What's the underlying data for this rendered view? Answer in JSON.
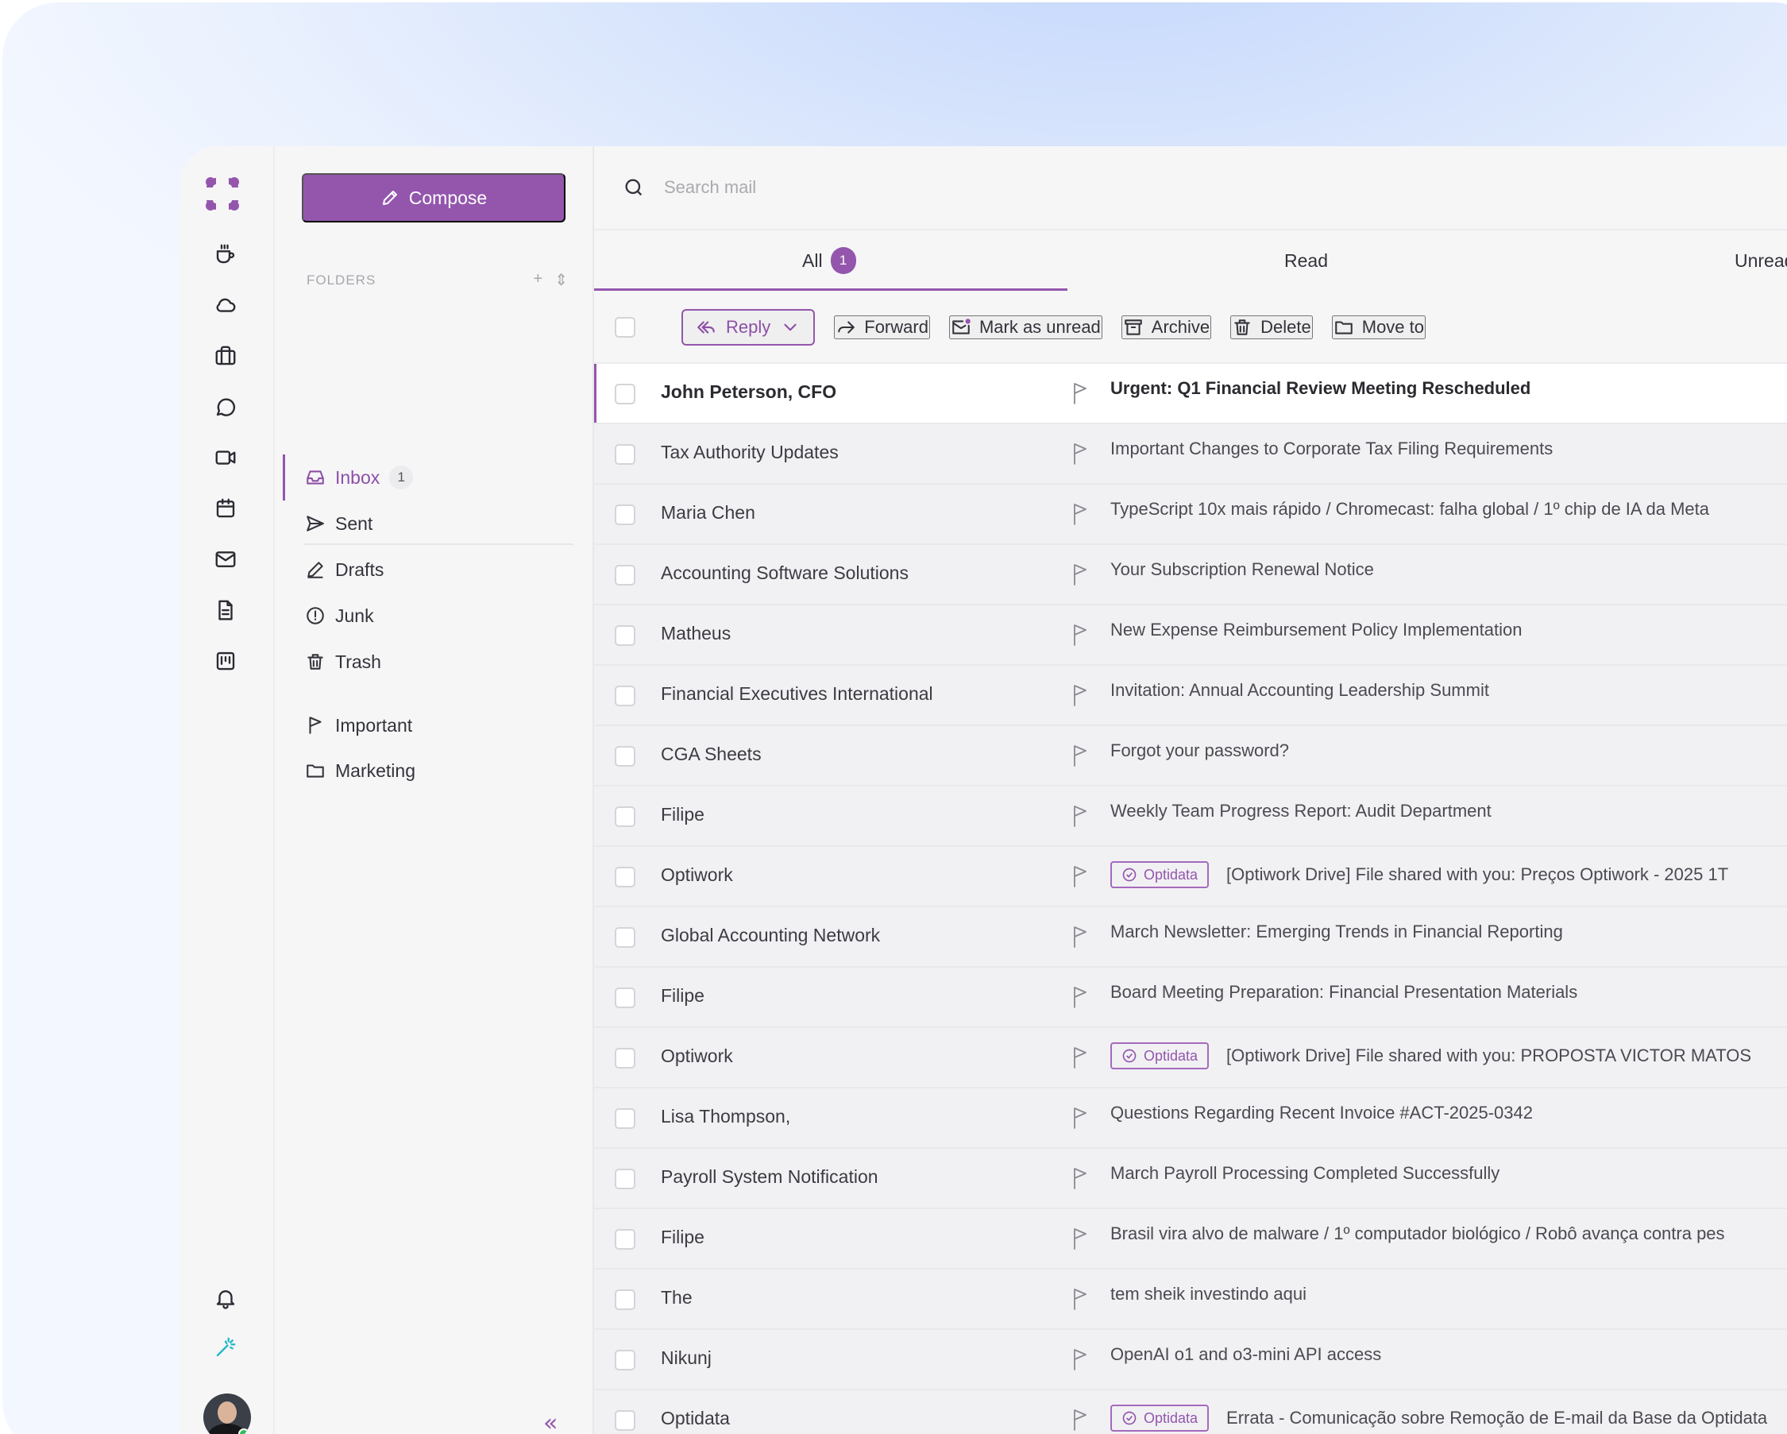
{
  "compose_label": "Compose",
  "folders_heading": "FOLDERS",
  "folders": [
    {
      "label": "Inbox",
      "count": "1",
      "icon": "inbox-icon"
    },
    {
      "label": "Sent",
      "icon": "send-icon"
    },
    {
      "label": "Drafts",
      "icon": "pencil-icon"
    },
    {
      "label": "Junk",
      "icon": "alert-icon"
    },
    {
      "label": "Trash",
      "icon": "trash-icon"
    }
  ],
  "custom_folders": [
    {
      "label": "Important",
      "icon": "flag-icon"
    },
    {
      "label": "Marketing",
      "icon": "folder-icon"
    }
  ],
  "search_placeholder": "Search mail",
  "tabs": [
    {
      "label": "All",
      "badge": "1"
    },
    {
      "label": "Read"
    },
    {
      "label": "Unread"
    }
  ],
  "toolbar": {
    "reply": "Reply",
    "forward": "Forward",
    "mark_unread": "Mark as unread",
    "archive": "Archive",
    "delete": "Delete",
    "move_to": "Move to"
  },
  "emails": [
    {
      "sender": "John Peterson, CFO",
      "subject": "Urgent: Q1 Financial Review Meeting Rescheduled",
      "unread": true
    },
    {
      "sender": "Tax Authority Updates",
      "subject": "Important Changes to Corporate Tax Filing Requirements"
    },
    {
      "sender": "Maria Chen",
      "subject": "TypeScript 10x mais rápido / Chromecast: falha global / 1º chip de IA da Meta"
    },
    {
      "sender": "Accounting Software Solutions",
      "subject": "Your Subscription Renewal Notice"
    },
    {
      "sender": "Matheus",
      "subject": "New Expense Reimbursement Policy Implementation"
    },
    {
      "sender": "Financial Executives International",
      "subject": "Invitation: Annual Accounting Leadership Summit"
    },
    {
      "sender": "CGA Sheets",
      "subject": "Forgot your password?"
    },
    {
      "sender": "Filipe",
      "subject": "Weekly Team Progress Report: Audit Department"
    },
    {
      "sender": "Optiwork",
      "tag": "Optidata",
      "subject": "[Optiwork Drive] File shared with you: Preços Optiwork - 2025 1T"
    },
    {
      "sender": "Global Accounting Network",
      "subject": "March Newsletter: Emerging Trends in Financial Reporting"
    },
    {
      "sender": "Filipe",
      "subject": "Board Meeting Preparation: Financial Presentation Materials"
    },
    {
      "sender": "Optiwork",
      "tag": "Optidata",
      "subject": "[Optiwork Drive] File shared with you: PROPOSTA VICTOR MATOS"
    },
    {
      "sender": "Lisa Thompson,",
      "subject": "Questions Regarding Recent Invoice #ACT-2025-0342"
    },
    {
      "sender": "Payroll System Notification",
      "subject": "March Payroll Processing Completed Successfully"
    },
    {
      "sender": "Filipe",
      "subject": "Brasil vira alvo de malware / 1º computador biológico / Robô avança contra pes"
    },
    {
      "sender": "The",
      "subject": "tem sheik investindo aqui"
    },
    {
      "sender": "Nikunj",
      "subject": "OpenAI o1 and o3-mini API access"
    },
    {
      "sender": "Optidata",
      "tag": "Optidata",
      "subject": "Errata - Comunicação sobre Remoção de E-mail da Base da Optidata"
    }
  ],
  "rail_icons": [
    "coffee-icon",
    "cloud-icon",
    "briefcase-icon",
    "chat-icon",
    "video-icon",
    "calendar-icon",
    "mail-icon",
    "document-icon",
    "board-icon",
    "bell-icon",
    "magic-wand-icon"
  ],
  "colors": {
    "accent": "#9456ad",
    "cyan": "#22b8c9"
  }
}
